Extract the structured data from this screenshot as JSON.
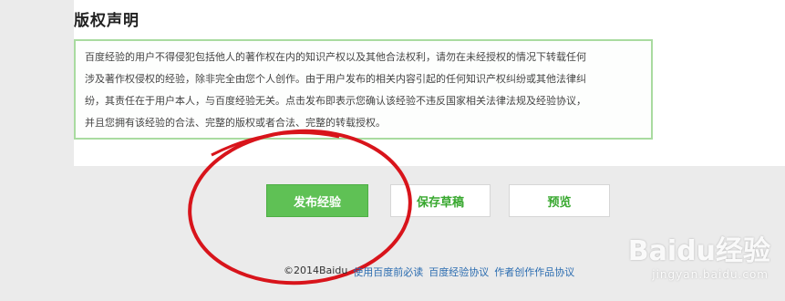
{
  "copyright_section": {
    "title": "版权声明",
    "lines": [
      "百度经验的用户不得侵犯包括他人的著作权在内的知识产权以及其他合法权利，请勿在未经授权的情况下转载任何",
      "涉及著作权侵权的经验，除非完全由您个人创作。由于用户发布的相关内容引起的任何知识产权纠纷或其他法律纠",
      "纷，其责任在于用户本人，与百度经验无关。点击发布即表示您确认该经验不违反国家相关法律法规及经验协议，",
      "并且您拥有该经验的合法、完整的版权或者合法、完整的转载授权。"
    ]
  },
  "actions": {
    "publish": "发布经验",
    "save_draft": "保存草稿",
    "preview": "预览"
  },
  "footer": {
    "copyright": "©2014Baidu",
    "links": [
      "使用百度前必读",
      "百度经验协议",
      "作者创作作品协议"
    ]
  },
  "watermark": {
    "logo": "Baidu经验",
    "url": "jingyan.baidu.com"
  },
  "colors": {
    "primary_green": "#5fc155",
    "annotation_red": "#d8141b",
    "notice_border": "#a9dba0",
    "link_blue": "#2b6cb0"
  }
}
